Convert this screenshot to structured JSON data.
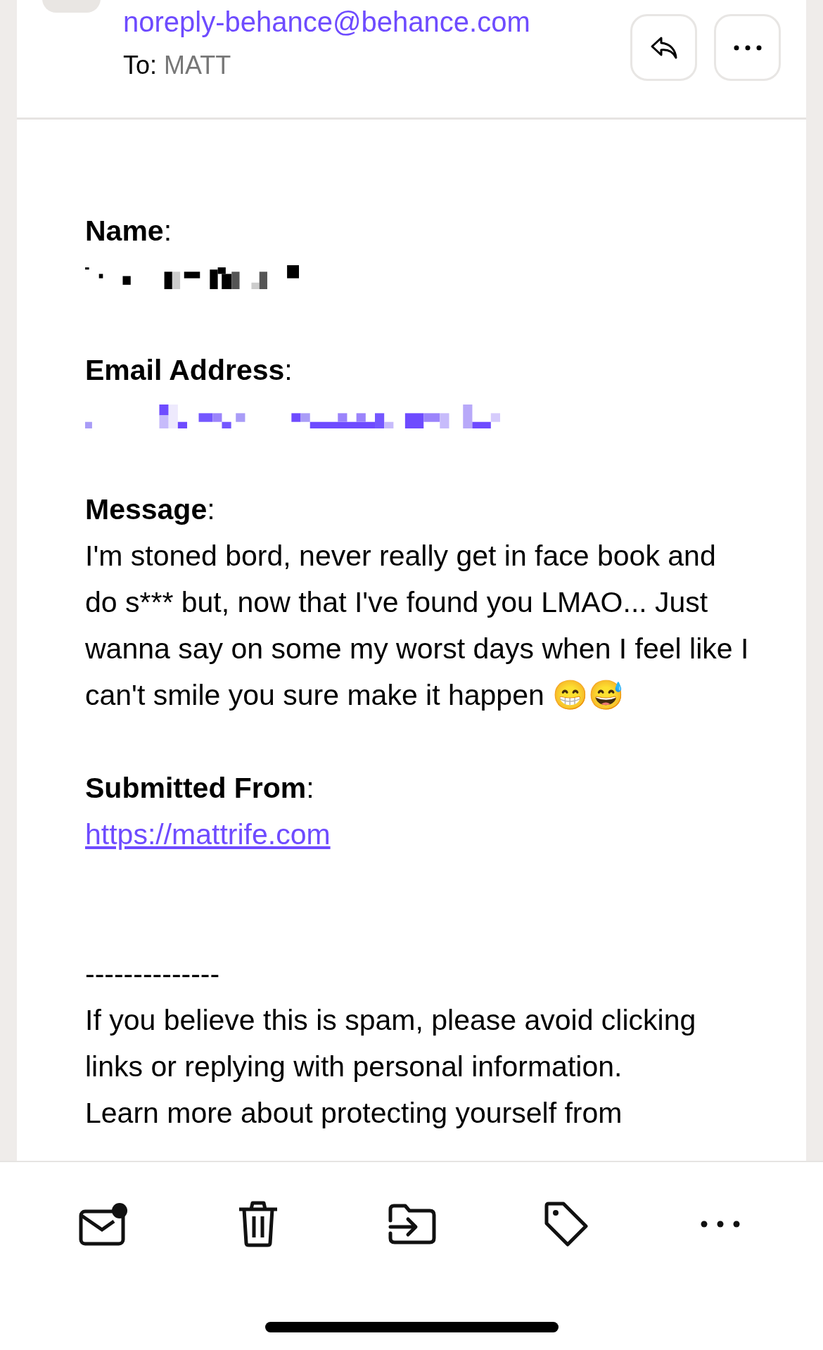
{
  "header": {
    "sender": "noreply-behance@behance.com",
    "to_label": "To:",
    "to_name": "MATT"
  },
  "fields": [
    {
      "label": "**Name**:",
      "kind": "redacted_text"
    },
    {
      "label": "**Email Address**:",
      "kind": "redacted_link"
    },
    {
      "label": "**Message**:",
      "kind": "text",
      "value": "I'm stoned bord, never really get in face book and do s*** but, now that I've found you LMAO... Just wanna say on some my worst days when I feel like I can't smile you sure make it happen 😁😅"
    },
    {
      "label": "**Submitted From**:",
      "kind": "link",
      "value": "https://mattrife.com"
    }
  ],
  "footer": {
    "rule": "--------------",
    "lines": [
      "If you believe this is spam, please avoid clicking links or replying with personal information.",
      "Learn more about protecting yourself from"
    ]
  },
  "toolbar": {
    "unread": true
  }
}
